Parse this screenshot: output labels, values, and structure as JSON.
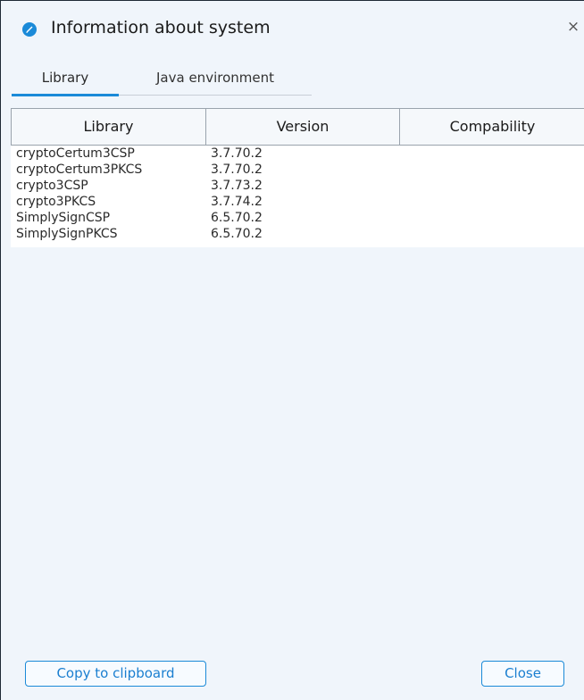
{
  "window": {
    "title": "Information about system",
    "icon": "app-logo-icon",
    "close_symbol": "×",
    "accent_color": "#1b8ad8"
  },
  "tabs": [
    {
      "label": "Library",
      "active": true
    },
    {
      "label": "Java environment",
      "active": false
    }
  ],
  "table": {
    "columns": [
      "Library",
      "Version",
      "Compability"
    ],
    "rows": [
      {
        "library": "cryptoCertum3CSP",
        "version": "3.7.70.2",
        "compability": ""
      },
      {
        "library": "cryptoCertum3PKCS",
        "version": "3.7.70.2",
        "compability": ""
      },
      {
        "library": "crypto3CSP",
        "version": "3.7.73.2",
        "compability": ""
      },
      {
        "library": "crypto3PKCS",
        "version": "3.7.74.2",
        "compability": ""
      },
      {
        "library": "SimplySignCSP",
        "version": "6.5.70.2",
        "compability": ""
      },
      {
        "library": "SimplySignPKCS",
        "version": "6.5.70.2",
        "compability": ""
      }
    ]
  },
  "footer": {
    "copy_label": "Copy to clipboard",
    "close_label": "Close"
  }
}
